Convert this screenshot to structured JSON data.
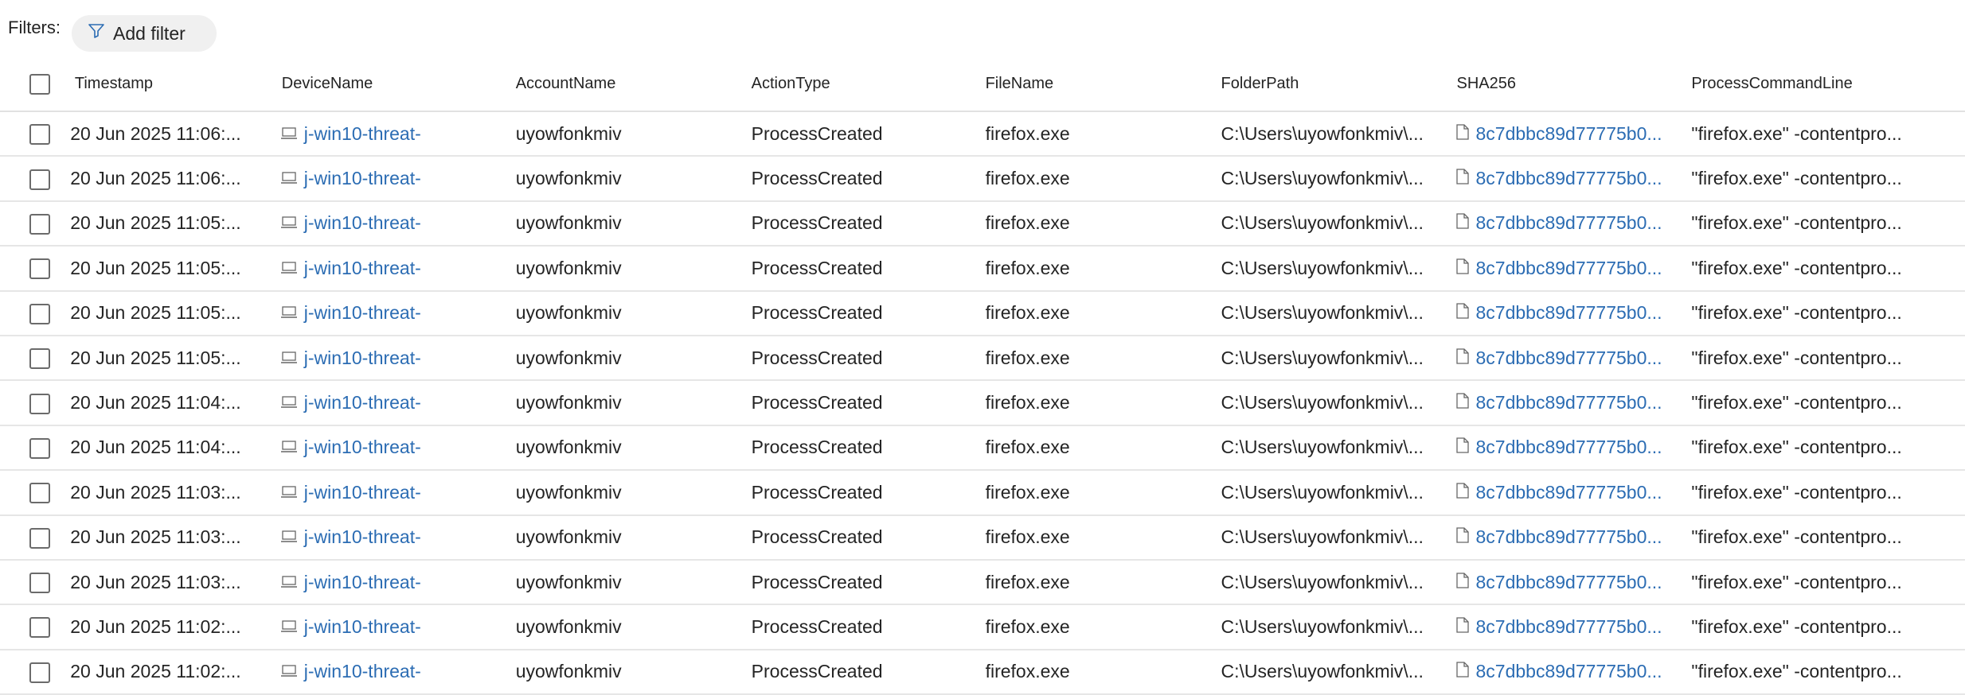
{
  "filters": {
    "label": "Filters:",
    "add_filter_label": "Add filter"
  },
  "columns": [
    "Timestamp",
    "DeviceName",
    "AccountName",
    "ActionType",
    "FileName",
    "FolderPath",
    "SHA256",
    "ProcessCommandLine"
  ],
  "rows": [
    {
      "timestamp": "20 Jun 2025 11:06:...",
      "device": "j-win10-threat-",
      "account": "uyowfonkmiv",
      "action": "ProcessCreated",
      "file": "firefox.exe",
      "folder": "C:\\Users\\uyowfonkmiv\\...",
      "sha": "8c7dbbc89d77775b0...",
      "cmd": "\"firefox.exe\" -contentpro..."
    },
    {
      "timestamp": "20 Jun 2025 11:06:...",
      "device": "j-win10-threat-",
      "account": "uyowfonkmiv",
      "action": "ProcessCreated",
      "file": "firefox.exe",
      "folder": "C:\\Users\\uyowfonkmiv\\...",
      "sha": "8c7dbbc89d77775b0...",
      "cmd": "\"firefox.exe\" -contentpro..."
    },
    {
      "timestamp": "20 Jun 2025 11:05:...",
      "device": "j-win10-threat-",
      "account": "uyowfonkmiv",
      "action": "ProcessCreated",
      "file": "firefox.exe",
      "folder": "C:\\Users\\uyowfonkmiv\\...",
      "sha": "8c7dbbc89d77775b0...",
      "cmd": "\"firefox.exe\" -contentpro..."
    },
    {
      "timestamp": "20 Jun 2025 11:05:...",
      "device": "j-win10-threat-",
      "account": "uyowfonkmiv",
      "action": "ProcessCreated",
      "file": "firefox.exe",
      "folder": "C:\\Users\\uyowfonkmiv\\...",
      "sha": "8c7dbbc89d77775b0...",
      "cmd": "\"firefox.exe\" -contentpro..."
    },
    {
      "timestamp": "20 Jun 2025 11:05:...",
      "device": "j-win10-threat-",
      "account": "uyowfonkmiv",
      "action": "ProcessCreated",
      "file": "firefox.exe",
      "folder": "C:\\Users\\uyowfonkmiv\\...",
      "sha": "8c7dbbc89d77775b0...",
      "cmd": "\"firefox.exe\" -contentpro..."
    },
    {
      "timestamp": "20 Jun 2025 11:05:...",
      "device": "j-win10-threat-",
      "account": "uyowfonkmiv",
      "action": "ProcessCreated",
      "file": "firefox.exe",
      "folder": "C:\\Users\\uyowfonkmiv\\...",
      "sha": "8c7dbbc89d77775b0...",
      "cmd": "\"firefox.exe\" -contentpro..."
    },
    {
      "timestamp": "20 Jun 2025 11:04:...",
      "device": "j-win10-threat-",
      "account": "uyowfonkmiv",
      "action": "ProcessCreated",
      "file": "firefox.exe",
      "folder": "C:\\Users\\uyowfonkmiv\\...",
      "sha": "8c7dbbc89d77775b0...",
      "cmd": "\"firefox.exe\" -contentpro..."
    },
    {
      "timestamp": "20 Jun 2025 11:04:...",
      "device": "j-win10-threat-",
      "account": "uyowfonkmiv",
      "action": "ProcessCreated",
      "file": "firefox.exe",
      "folder": "C:\\Users\\uyowfonkmiv\\...",
      "sha": "8c7dbbc89d77775b0...",
      "cmd": "\"firefox.exe\" -contentpro..."
    },
    {
      "timestamp": "20 Jun 2025 11:03:...",
      "device": "j-win10-threat-",
      "account": "uyowfonkmiv",
      "action": "ProcessCreated",
      "file": "firefox.exe",
      "folder": "C:\\Users\\uyowfonkmiv\\...",
      "sha": "8c7dbbc89d77775b0...",
      "cmd": "\"firefox.exe\" -contentpro..."
    },
    {
      "timestamp": "20 Jun 2025 11:03:...",
      "device": "j-win10-threat-",
      "account": "uyowfonkmiv",
      "action": "ProcessCreated",
      "file": "firefox.exe",
      "folder": "C:\\Users\\uyowfonkmiv\\...",
      "sha": "8c7dbbc89d77775b0...",
      "cmd": "\"firefox.exe\" -contentpro..."
    },
    {
      "timestamp": "20 Jun 2025 11:03:...",
      "device": "j-win10-threat-",
      "account": "uyowfonkmiv",
      "action": "ProcessCreated",
      "file": "firefox.exe",
      "folder": "C:\\Users\\uyowfonkmiv\\...",
      "sha": "8c7dbbc89d77775b0...",
      "cmd": "\"firefox.exe\" -contentpro..."
    },
    {
      "timestamp": "20 Jun 2025 11:02:...",
      "device": "j-win10-threat-",
      "account": "uyowfonkmiv",
      "action": "ProcessCreated",
      "file": "firefox.exe",
      "folder": "C:\\Users\\uyowfonkmiv\\...",
      "sha": "8c7dbbc89d77775b0...",
      "cmd": "\"firefox.exe\" -contentpro..."
    },
    {
      "timestamp": "20 Jun 2025 11:02:...",
      "device": "j-win10-threat-",
      "account": "uyowfonkmiv",
      "action": "ProcessCreated",
      "file": "firefox.exe",
      "folder": "C:\\Users\\uyowfonkmiv\\...",
      "sha": "8c7dbbc89d77775b0...",
      "cmd": "\"firefox.exe\" -contentpro..."
    }
  ],
  "icons": {
    "filter": "filter-icon",
    "device": "laptop-icon",
    "sha": "file-icon",
    "expand": "chevron-right-icon"
  },
  "colors": {
    "link": "#2b6cb3",
    "row_divider": "#e6e6e6",
    "button_bg": "#f0f0f0"
  }
}
